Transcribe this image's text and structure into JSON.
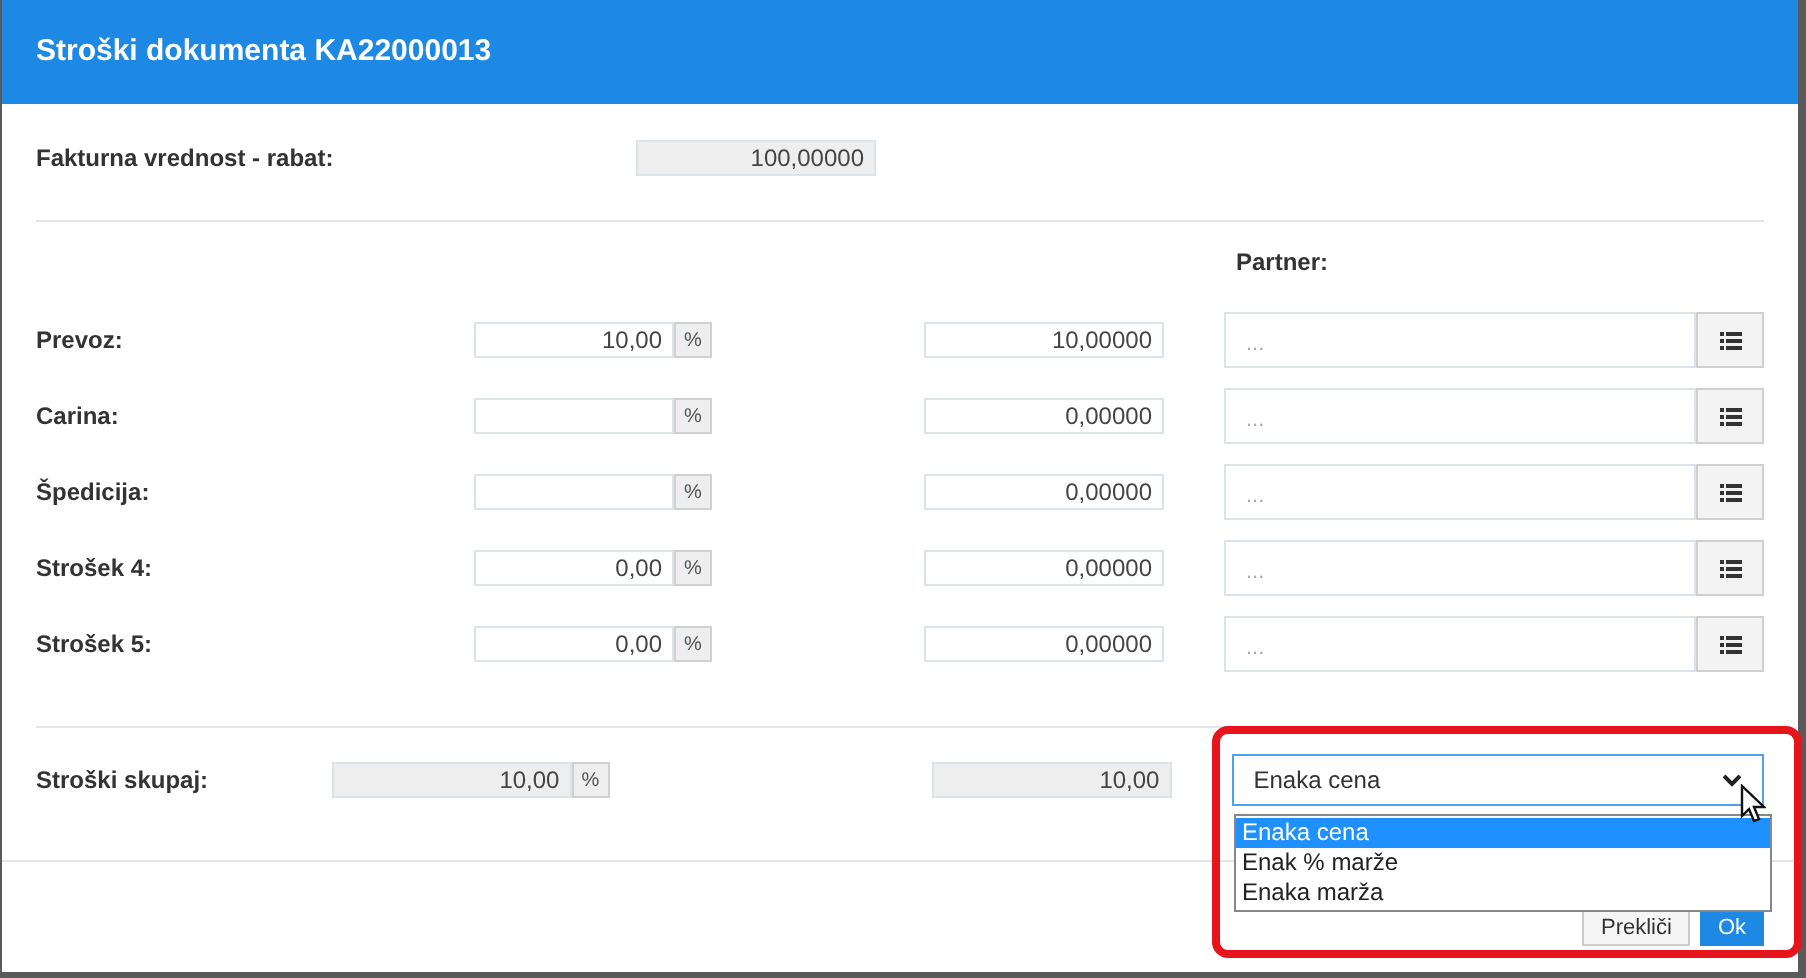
{
  "dialog": {
    "title": "Stroški dokumenta KA22000013",
    "invoice_value": {
      "label": "Fakturna vrednost - rabat:",
      "value": "100,00000"
    },
    "partner_heading": "Partner:",
    "costs": [
      {
        "label": "Prevoz:",
        "percent": "10,00",
        "percent_unit": "%",
        "amount": "10,00000",
        "partner_placeholder": "..."
      },
      {
        "label": "Carina:",
        "percent_unit": "%",
        "amount": "0,00000",
        "partner_placeholder": "..."
      },
      {
        "label": "Špedicija:",
        "percent_unit": "%",
        "amount": "0,00000",
        "partner_placeholder": "..."
      },
      {
        "label": "Strošek 4:",
        "percent": "0,00",
        "percent_unit": "%",
        "amount": "0,00000",
        "partner_placeholder": "..."
      },
      {
        "label": "Strošek 5:",
        "percent": "0,00",
        "percent_unit": "%",
        "amount": "0,00000",
        "partner_placeholder": "..."
      }
    ],
    "total": {
      "label": "Stroški skupaj:",
      "percent": "10,00",
      "percent_unit": "%",
      "amount": "10,00"
    },
    "distribution_select": {
      "value": "Enaka cena",
      "expanded": true,
      "options": [
        {
          "label": "Enaka cena",
          "selected": true
        },
        {
          "label": "Enak % marže",
          "selected": false
        },
        {
          "label": "Enaka marža",
          "selected": false
        }
      ]
    },
    "buttons": [
      "Prekliči",
      "Ok"
    ]
  }
}
